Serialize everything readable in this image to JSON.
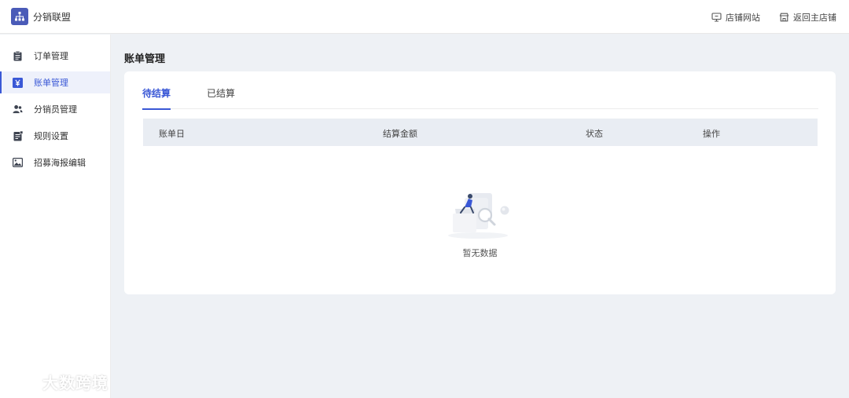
{
  "brand": {
    "name": "分销联盟",
    "logo_icon": "network-icon",
    "accent": "#4a5bb8"
  },
  "header": {
    "links": [
      {
        "label": "店铺网站",
        "icon": "monitor-icon"
      },
      {
        "label": "返回主店铺",
        "icon": "store-icon"
      }
    ]
  },
  "sidebar": {
    "items": [
      {
        "label": "订单管理",
        "icon": "clipboard-icon"
      },
      {
        "label": "账单管理",
        "icon": "yen-icon",
        "active": true
      },
      {
        "label": "分销员管理",
        "icon": "users-icon"
      },
      {
        "label": "规则设置",
        "icon": "document-icon"
      },
      {
        "label": "招募海报编辑",
        "icon": "image-icon"
      }
    ]
  },
  "page": {
    "title": "账单管理",
    "tabs": [
      {
        "label": "待结算",
        "active": true
      },
      {
        "label": "已结算"
      }
    ],
    "table": {
      "columns": [
        "账单日",
        "结算金额",
        "状态",
        "操作"
      ]
    },
    "empty_text": "暂无数据"
  },
  "watermark": {
    "text": "大数跨境"
  },
  "colors": {
    "primary": "#3a58d6",
    "background": "#eef1f5",
    "table_header": "#e9edf3"
  }
}
